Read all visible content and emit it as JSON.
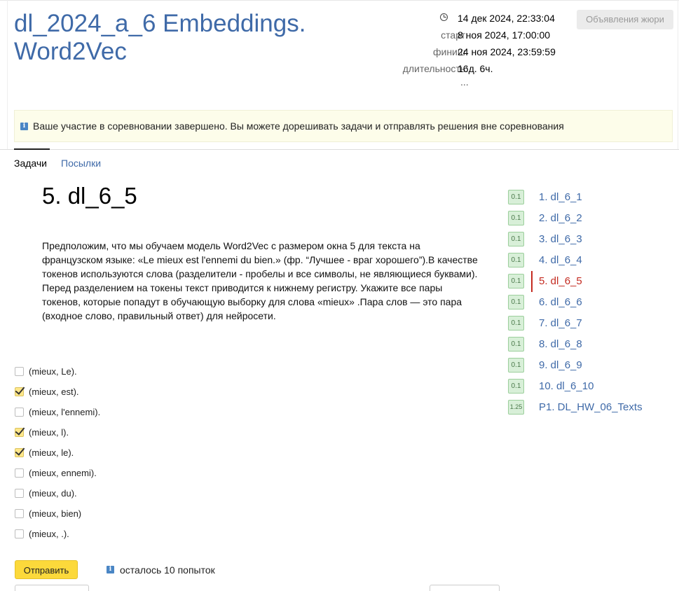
{
  "contest": {
    "title": "dl_2024_a_6 Embeddings. Word2Vec",
    "current_time": "14 дек 2024, 22:33:04",
    "start_label": "старт:",
    "start_value": "8 ноя 2024, 17:00:00",
    "finish_label": "финиш:",
    "finish_value": "24 ноя 2024, 23:59:59",
    "duration_label": "длительность:",
    "duration_value": "16д. 6ч.",
    "ellipsis": "...",
    "jury_button": "Объявления жюри"
  },
  "notice": {
    "icon": "info-icon",
    "text": "Ваше участие в соревновании завершено. Вы можете дорешивать задачи и отправлять решения вне соревнования"
  },
  "tabs": [
    {
      "label": "Задачи",
      "active": true
    },
    {
      "label": "Посылки",
      "active": false
    }
  ],
  "problem": {
    "title": "5. dl_6_5",
    "statement": "Предположим, что мы обучаем модель Word2Vec с размером окна 5 для текста на французском языке: «Le mieux est l'ennemi du bien.» (фр. “Лучшее - враг хорошего”).В качестве токенов используются слова (разделители - пробелы и все символы, не являющиеся буквами). Перед разделением на токены текст приводится к нижнему регистру. Укажите все пары токенов, которые попадут в обучающую выборку для слова «mieux» .Пара слов — это пара (входное слово, правильный ответ) для нейросети.",
    "options": [
      {
        "label": "(mieux, Le).",
        "checked": false
      },
      {
        "label": "(mieux, est).",
        "checked": true
      },
      {
        "label": "(mieux, l'ennemi).",
        "checked": false
      },
      {
        "label": "(mieux, l).",
        "checked": true
      },
      {
        "label": "(mieux, le).",
        "checked": true
      },
      {
        "label": "(mieux, ennemi).",
        "checked": false
      },
      {
        "label": "(mieux, du).",
        "checked": false
      },
      {
        "label": "(mieux, bien)",
        "checked": false
      },
      {
        "label": "(mieux, .).",
        "checked": false
      }
    ],
    "submit_label": "Отправить",
    "attempts_text": "осталось 10 попыток"
  },
  "problem_list": [
    {
      "score": "0.1",
      "label": "1. dl_6_1",
      "active": false
    },
    {
      "score": "0.1",
      "label": "2. dl_6_2",
      "active": false
    },
    {
      "score": "0.1",
      "label": "3. dl_6_3",
      "active": false
    },
    {
      "score": "0.1",
      "label": "4. dl_6_4",
      "active": false
    },
    {
      "score": "0.1",
      "label": "5. dl_6_5",
      "active": true
    },
    {
      "score": "0.1",
      "label": "6. dl_6_6",
      "active": false
    },
    {
      "score": "0.1",
      "label": "7. dl_6_7",
      "active": false
    },
    {
      "score": "0.1",
      "label": "8. dl_6_8",
      "active": false
    },
    {
      "score": "0.1",
      "label": "9. dl_6_9",
      "active": false
    },
    {
      "score": "0.1",
      "label": "10. dl_6_10",
      "active": false
    },
    {
      "score": "1.25",
      "label": "P1. DL_HW_06_Texts",
      "active": false
    }
  ],
  "colors": {
    "link": "#3f6aa8",
    "active_link": "#c42b21",
    "submit_bg": "#fcd93b",
    "notice_bg": "#fdfdea",
    "badge_bg": "#d8efd8"
  }
}
